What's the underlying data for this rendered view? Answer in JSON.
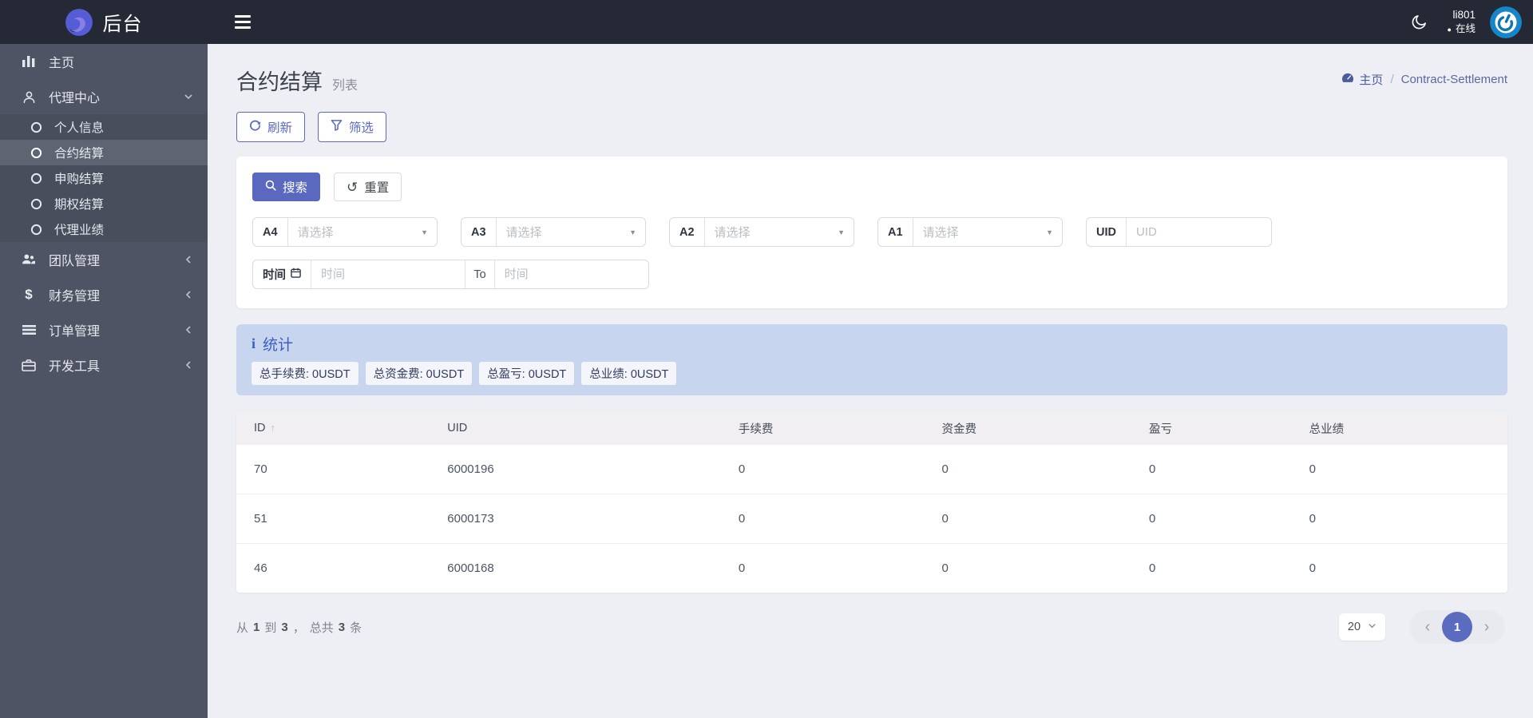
{
  "header": {
    "brand": "后台",
    "user": {
      "name": "li801",
      "status": "在线",
      "dot": "●"
    }
  },
  "sidebar": {
    "items": [
      {
        "label": "主页"
      },
      {
        "label": "代理中心"
      },
      {
        "label": "团队管理"
      },
      {
        "label": "财务管理"
      },
      {
        "label": "订单管理"
      },
      {
        "label": "开发工具"
      }
    ],
    "submenu": [
      {
        "label": "个人信息"
      },
      {
        "label": "合约结算"
      },
      {
        "label": "申购结算"
      },
      {
        "label": "期权结算"
      },
      {
        "label": "代理业绩"
      }
    ],
    "dollar_icon": "$"
  },
  "page": {
    "title": "合约结算",
    "subtitle": "列表"
  },
  "breadcrumb": {
    "home": "主页",
    "separator": "/",
    "current": "Contract-Settlement"
  },
  "toolbar": {
    "refresh": "刷新",
    "filter": "筛选"
  },
  "search": {
    "submit": "搜索",
    "reset": "重置",
    "reset_icon": "↺",
    "select_caret": "▼",
    "selects": [
      {
        "label": "A4",
        "placeholder": "请选择"
      },
      {
        "label": "A3",
        "placeholder": "请选择"
      },
      {
        "label": "A2",
        "placeholder": "请选择"
      },
      {
        "label": "A1",
        "placeholder": "请选择"
      }
    ],
    "uid": {
      "label": "UID",
      "placeholder": "UID"
    },
    "time": {
      "label": "时间",
      "from_placeholder": "时间",
      "to_label": "To",
      "to_placeholder": "时间"
    }
  },
  "stats": {
    "icon": "i",
    "title": "统计",
    "badges": [
      {
        "text": "总手续费: 0USDT"
      },
      {
        "text": "总资金费: 0USDT"
      },
      {
        "text": "总盈亏: 0USDT"
      },
      {
        "text": "总业绩: 0USDT"
      }
    ]
  },
  "table": {
    "columns": [
      {
        "label": "ID",
        "sort": "↑"
      },
      {
        "label": "UID"
      },
      {
        "label": "手续费"
      },
      {
        "label": "资金费"
      },
      {
        "label": "盈亏"
      },
      {
        "label": "总业绩"
      }
    ],
    "rows": [
      {
        "id": "70",
        "uid": "6000196",
        "fee": "0",
        "funding": "0",
        "pnl": "0",
        "total": "0"
      },
      {
        "id": "51",
        "uid": "6000173",
        "fee": "0",
        "funding": "0",
        "pnl": "0",
        "total": "0"
      },
      {
        "id": "46",
        "uid": "6000168",
        "fee": "0",
        "funding": "0",
        "pnl": "0",
        "total": "0"
      }
    ]
  },
  "footer": {
    "summary": {
      "from_label": "从",
      "from": "1",
      "to_label": "到",
      "to": "3",
      "comma": "，",
      "total_label": "总共",
      "total": "3",
      "unit": "条"
    },
    "page_size": "20",
    "pager": {
      "prev": "‹",
      "page": "1",
      "next": "›"
    }
  },
  "colors": {
    "accent": "#5a69bf",
    "topbar": "#242935",
    "sidebar": "#4e5464",
    "stats_bg": "#c7d6ee"
  }
}
